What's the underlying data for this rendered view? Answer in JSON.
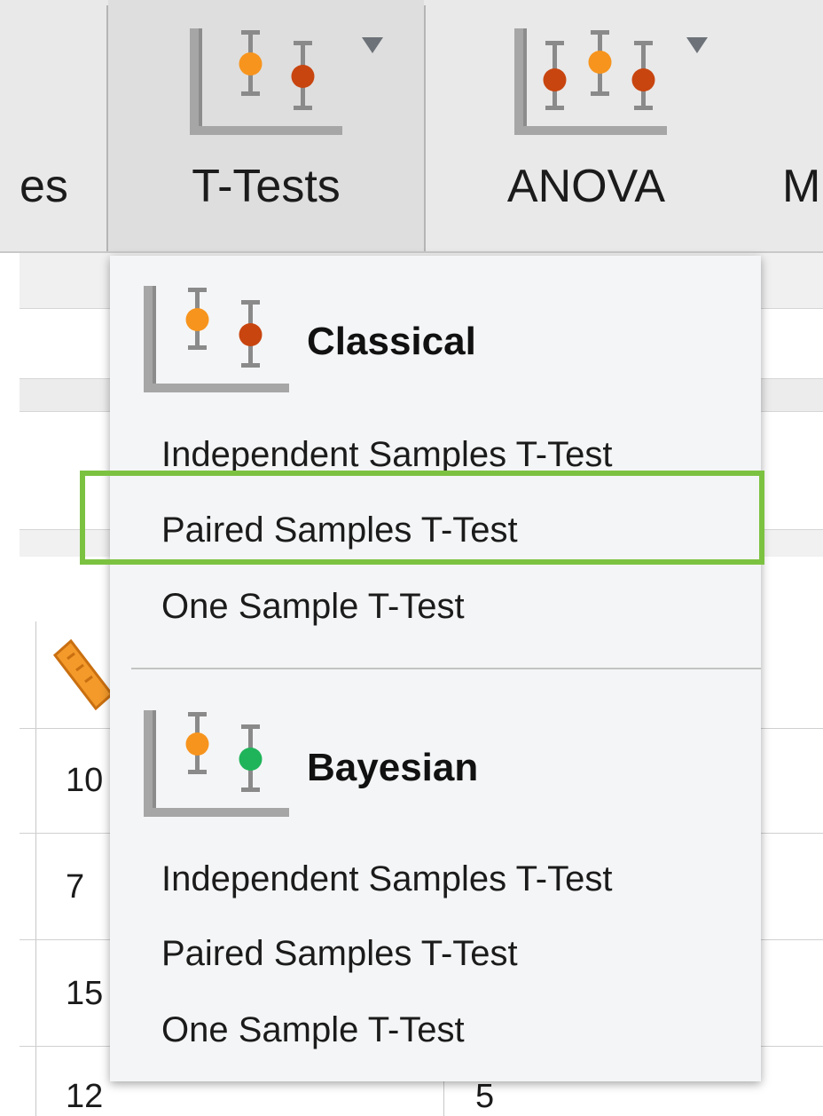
{
  "ribbon": {
    "left_label": "es",
    "ttests": {
      "label": "T-Tests",
      "icon": "ttest-chart-icon",
      "caret": "chevron-down-icon"
    },
    "anova": {
      "label": "ANOVA",
      "icon": "anova-chart-icon",
      "caret": "chevron-down-icon"
    },
    "right_label": "M"
  },
  "sheet": {
    "column_a": [
      "10",
      "7",
      "15",
      "12"
    ],
    "column_b_last": "5",
    "ruler_icon": "scale-ruler-icon"
  },
  "menu": {
    "classical": {
      "title": "Classical",
      "icon": "classical-ttest-icon",
      "items": [
        "Independent Samples T-Test",
        "Paired Samples T-Test",
        "One Sample T-Test"
      ]
    },
    "bayesian": {
      "title": "Bayesian",
      "icon": "bayesian-ttest-icon",
      "items": [
        "Independent Samples T-Test",
        "Paired Samples T-Test",
        "One Sample T-Test"
      ]
    }
  },
  "colors": {
    "highlight": "#7cc241",
    "orange_dot": "#f7941d",
    "red_dot": "#c8450f",
    "green_dot": "#1fb45a"
  }
}
